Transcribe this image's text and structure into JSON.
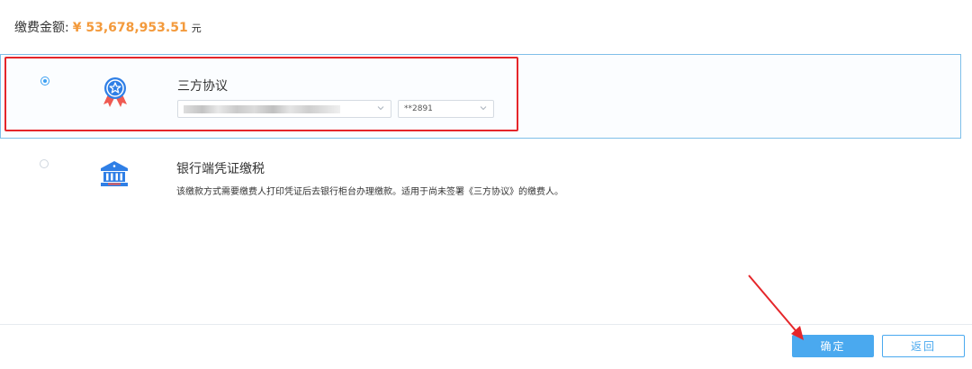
{
  "amount": {
    "label": "缴费金额:",
    "value": "¥ 53,678,953.51",
    "unit": "元"
  },
  "options": [
    {
      "title": "三方协议",
      "selected": true,
      "icon": "badge-star-icon",
      "bank_select": {
        "value": ""
      },
      "card_select": {
        "value": "**2891"
      }
    },
    {
      "title": "银行端凭证缴税",
      "selected": false,
      "icon": "bank-building-icon",
      "description": "该缴款方式需要缴费人打印凭证后去银行柜台办理缴款。适用于尚未签署《三方协议》的缴费人。"
    }
  ],
  "buttons": {
    "confirm_label": "确定",
    "back_label": "返回"
  },
  "colors": {
    "accent": "#4aa9ef",
    "amount": "#f39a3c",
    "annotation": "#e5262a"
  }
}
